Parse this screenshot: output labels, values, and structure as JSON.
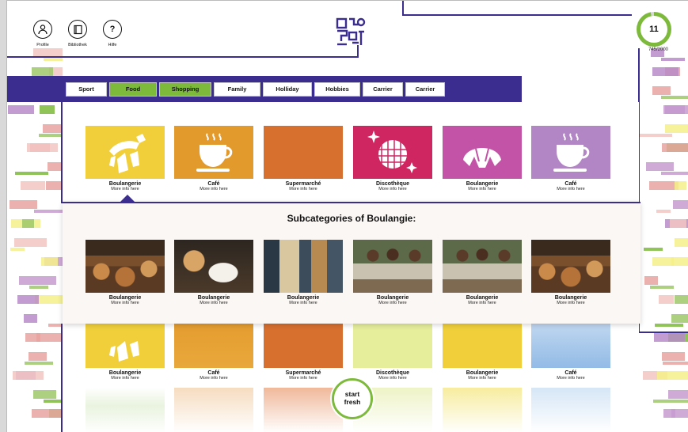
{
  "header": {
    "icons": [
      {
        "icon": "user-icon",
        "glyph": "👤",
        "label": "Profile"
      },
      {
        "icon": "book-icon",
        "glyph": "📖",
        "label": "Bibliothek"
      },
      {
        "icon": "help-icon",
        "glyph": "?",
        "label": "Hilfe"
      }
    ],
    "score": {
      "value": "11",
      "progress": "745/2000"
    }
  },
  "nav": {
    "tabs": [
      {
        "label": "Sport",
        "active": false
      },
      {
        "label": "Food",
        "active": true
      },
      {
        "label": "Shopping",
        "active": true
      },
      {
        "label": "Family",
        "active": false
      },
      {
        "label": "Holliday",
        "active": false
      },
      {
        "label": "Hobbies",
        "active": false
      },
      {
        "label": "Carrier",
        "active": false
      },
      {
        "label": "Carrier",
        "active": false
      }
    ]
  },
  "categories": [
    {
      "name": "Boulangerie",
      "sub": "More info here",
      "color": "#f0cf3a",
      "icon": "croissant-icon"
    },
    {
      "name": "Café",
      "sub": "More info here",
      "color": "#e39a2c",
      "icon": "coffee-cup-icon"
    },
    {
      "name": "Supermarché",
      "sub": "More info here",
      "color": "#d7702f",
      "icon": "none"
    },
    {
      "name": "Discothèque",
      "sub": "More info here",
      "color": "#cf2561",
      "icon": "disco-ball-icon"
    },
    {
      "name": "Boulangerie",
      "sub": "More info here",
      "color": "#c253a6",
      "icon": "croissant-icon"
    },
    {
      "name": "Café",
      "sub": "More info here",
      "color": "#b286c4",
      "icon": "coffee-cup-icon"
    }
  ],
  "subcategories": {
    "title": "Subcategories of Boulangie:",
    "items": [
      {
        "name": "Boulangerie",
        "sub": "More info here",
        "photo": "bread-photo"
      },
      {
        "name": "Boulangerie",
        "sub": "More info here",
        "photo": "cafe-photo"
      },
      {
        "name": "Boulangerie",
        "sub": "More info here",
        "photo": "shop-photo"
      },
      {
        "name": "Boulangerie",
        "sub": "More info here",
        "photo": "kids-photo"
      },
      {
        "name": "Boulangerie",
        "sub": "More info here",
        "photo": "kids-photo"
      },
      {
        "name": "Boulangerie",
        "sub": "More info here",
        "photo": "bread-photo"
      }
    ]
  },
  "lower_categories": [
    {
      "name": "Boulangerie",
      "sub": "More info here",
      "color": "#f0cf3a"
    },
    {
      "name": "Café",
      "sub": "More info here",
      "color": "#e39a2c"
    },
    {
      "name": "Supermarché",
      "sub": "More info here",
      "color": "#d7702f"
    },
    {
      "name": "Discothèque",
      "sub": "More info here",
      "color": "#e6ee9c"
    },
    {
      "name": "Boulangerie",
      "sub": "More info here",
      "color": "#f0cf3a"
    },
    {
      "name": "Café",
      "sub": "More info here",
      "color": "#92bbe6"
    }
  ],
  "bottom_row_colors": [
    "#7dba3c",
    "#e39a2c",
    "#d7702f",
    "#e6ee9c",
    "#f0cf3a",
    "#92bbe6"
  ],
  "start_button": {
    "line1": "start",
    "line2": "fresh"
  },
  "colors": {
    "brand": "#3b2c8f",
    "accent": "#7dba3c"
  }
}
